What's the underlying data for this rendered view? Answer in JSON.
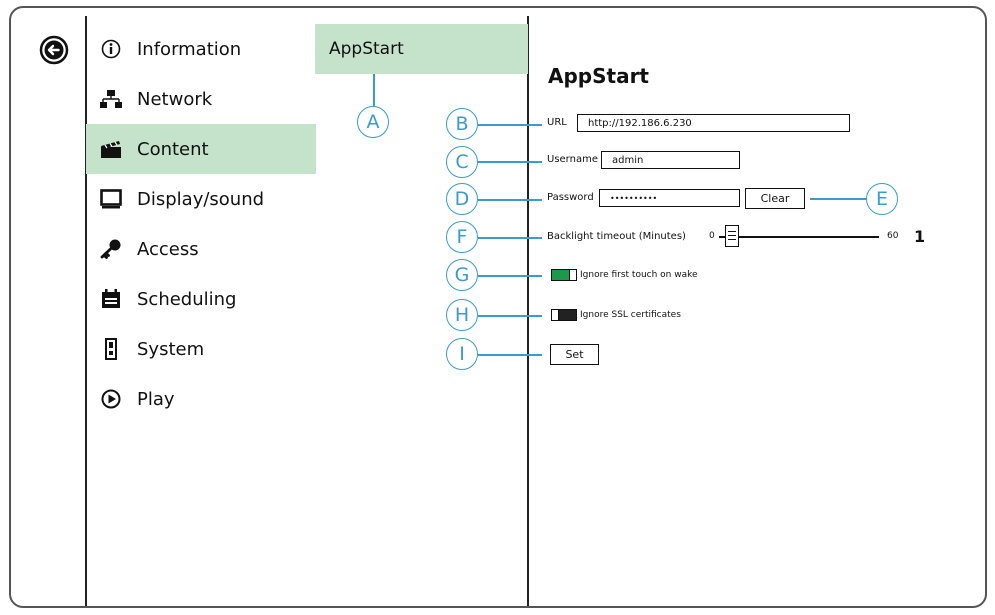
{
  "nav": {
    "back_icon": "arrow-left-circle-icon",
    "items": [
      {
        "label": "Information",
        "icon": "info-icon"
      },
      {
        "label": "Network",
        "icon": "network-icon"
      },
      {
        "label": "Content",
        "icon": "clapperboard-icon",
        "active": true
      },
      {
        "label": "Display/sound",
        "icon": "monitor-icon"
      },
      {
        "label": "Access",
        "icon": "key-icon"
      },
      {
        "label": "Scheduling",
        "icon": "calendar-icon"
      },
      {
        "label": "System",
        "icon": "device-icon"
      },
      {
        "label": "Play",
        "icon": "play-icon"
      }
    ]
  },
  "submenu": {
    "items": [
      {
        "label": "AppStart",
        "active": true
      }
    ]
  },
  "panel": {
    "title": "AppStart",
    "url_label": "URL",
    "url_value": "http://192.186.6.230",
    "username_label": "Username",
    "username_value": "admin",
    "password_label": "Password",
    "password_value": "••••••••••",
    "clear_label": "Clear",
    "backlight_label": "Backlight timeout (Minutes)",
    "slider_min": "0",
    "slider_max": "60",
    "slider_value": "1",
    "ignore_touch_label": "Ignore first touch on wake",
    "ignore_touch_on": true,
    "ignore_ssl_label": "Ignore SSL certificates",
    "ignore_ssl_on": false,
    "set_label": "Set"
  },
  "callouts": [
    "A",
    "B",
    "C",
    "D",
    "E",
    "F",
    "G",
    "H",
    "I"
  ],
  "colors": {
    "active_bg": "#c5e3cb",
    "callout": "#3a9bd0",
    "toggle_on": "#1a9a4a",
    "toggle_off": "#222222"
  }
}
